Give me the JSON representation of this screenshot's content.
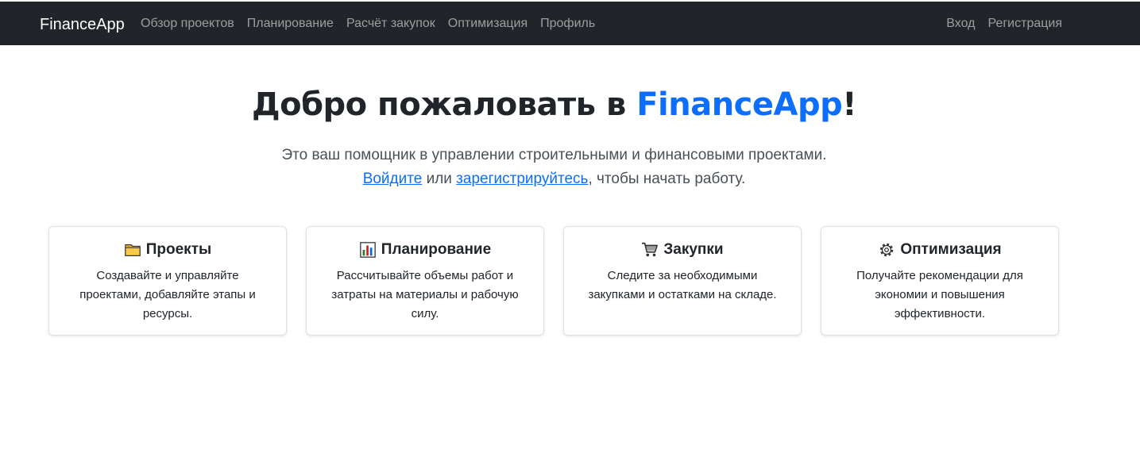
{
  "navbar": {
    "brand": "FinanceApp",
    "left_links": [
      "Обзор проектов",
      "Планирование",
      "Расчёт закупок",
      "Оптимизация",
      "Профиль"
    ],
    "right_links": [
      "Вход",
      "Регистрация"
    ]
  },
  "hero": {
    "title_prefix": "Добро пожаловать в ",
    "title_brand": "FinanceApp",
    "title_suffix": "!",
    "lead_line1": "Это ваш помощник в управлении строительными и финансовыми проектами.",
    "login_link": "Войдите",
    "or_text": " или ",
    "register_link": "зарегистрируйтесь",
    "lead_end": ", чтобы начать работу."
  },
  "cards": [
    {
      "icon": "folder-icon",
      "title": "Проекты",
      "text": "Создавайте и управляйте проектами, добавляйте этапы и ресурсы."
    },
    {
      "icon": "bar-chart-icon",
      "title": "Планирование",
      "text": "Рассчитывайте объемы работ и затраты на материалы и рабочую силу."
    },
    {
      "icon": "shopping-cart-icon",
      "title": "Закупки",
      "text": "Следите за необходимыми закупками и остатками на складе."
    },
    {
      "icon": "gear-icon",
      "title": "Оптимизация",
      "text": "Получайте рекомендации для экономии и повышения эффективности."
    }
  ],
  "colors": {
    "navbar_bg": "#212529",
    "accent": "#0d6efd"
  }
}
